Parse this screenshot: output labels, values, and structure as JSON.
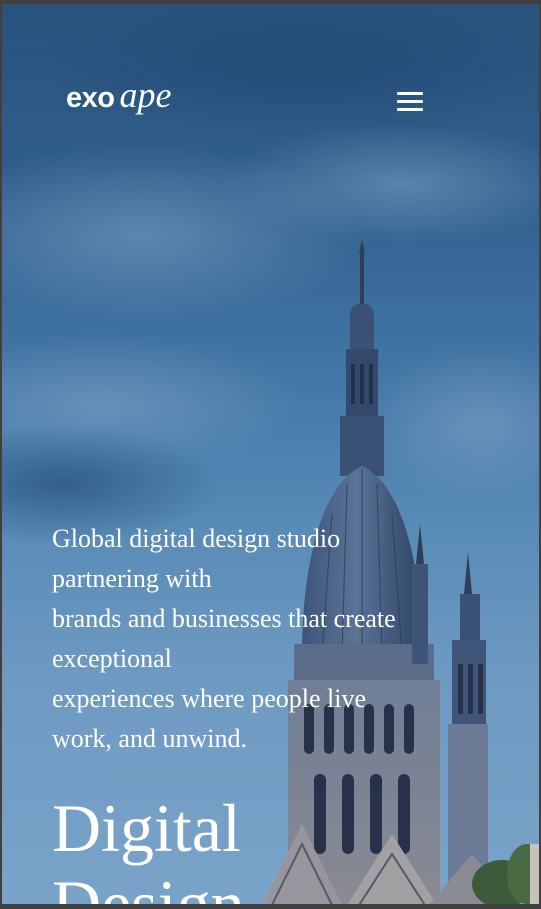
{
  "brand": {
    "logo_word": "exo",
    "logo_script": "ape"
  },
  "header": {
    "menu_icon": "hamburger-menu-icon"
  },
  "hero": {
    "tagline_lines": [
      "Global digital design studio",
      "partnering with",
      "brands and businesses that create",
      "exceptional",
      "experiences where people live",
      "work, and unwind."
    ],
    "headline_lines": [
      "Digital",
      "Design"
    ],
    "background_image": "cathedral-dome-at-dusk"
  },
  "colors": {
    "text": "#ffffff",
    "sky_top": "#29527c",
    "sky_bottom": "#7aa3c8",
    "frame": "#404040"
  }
}
